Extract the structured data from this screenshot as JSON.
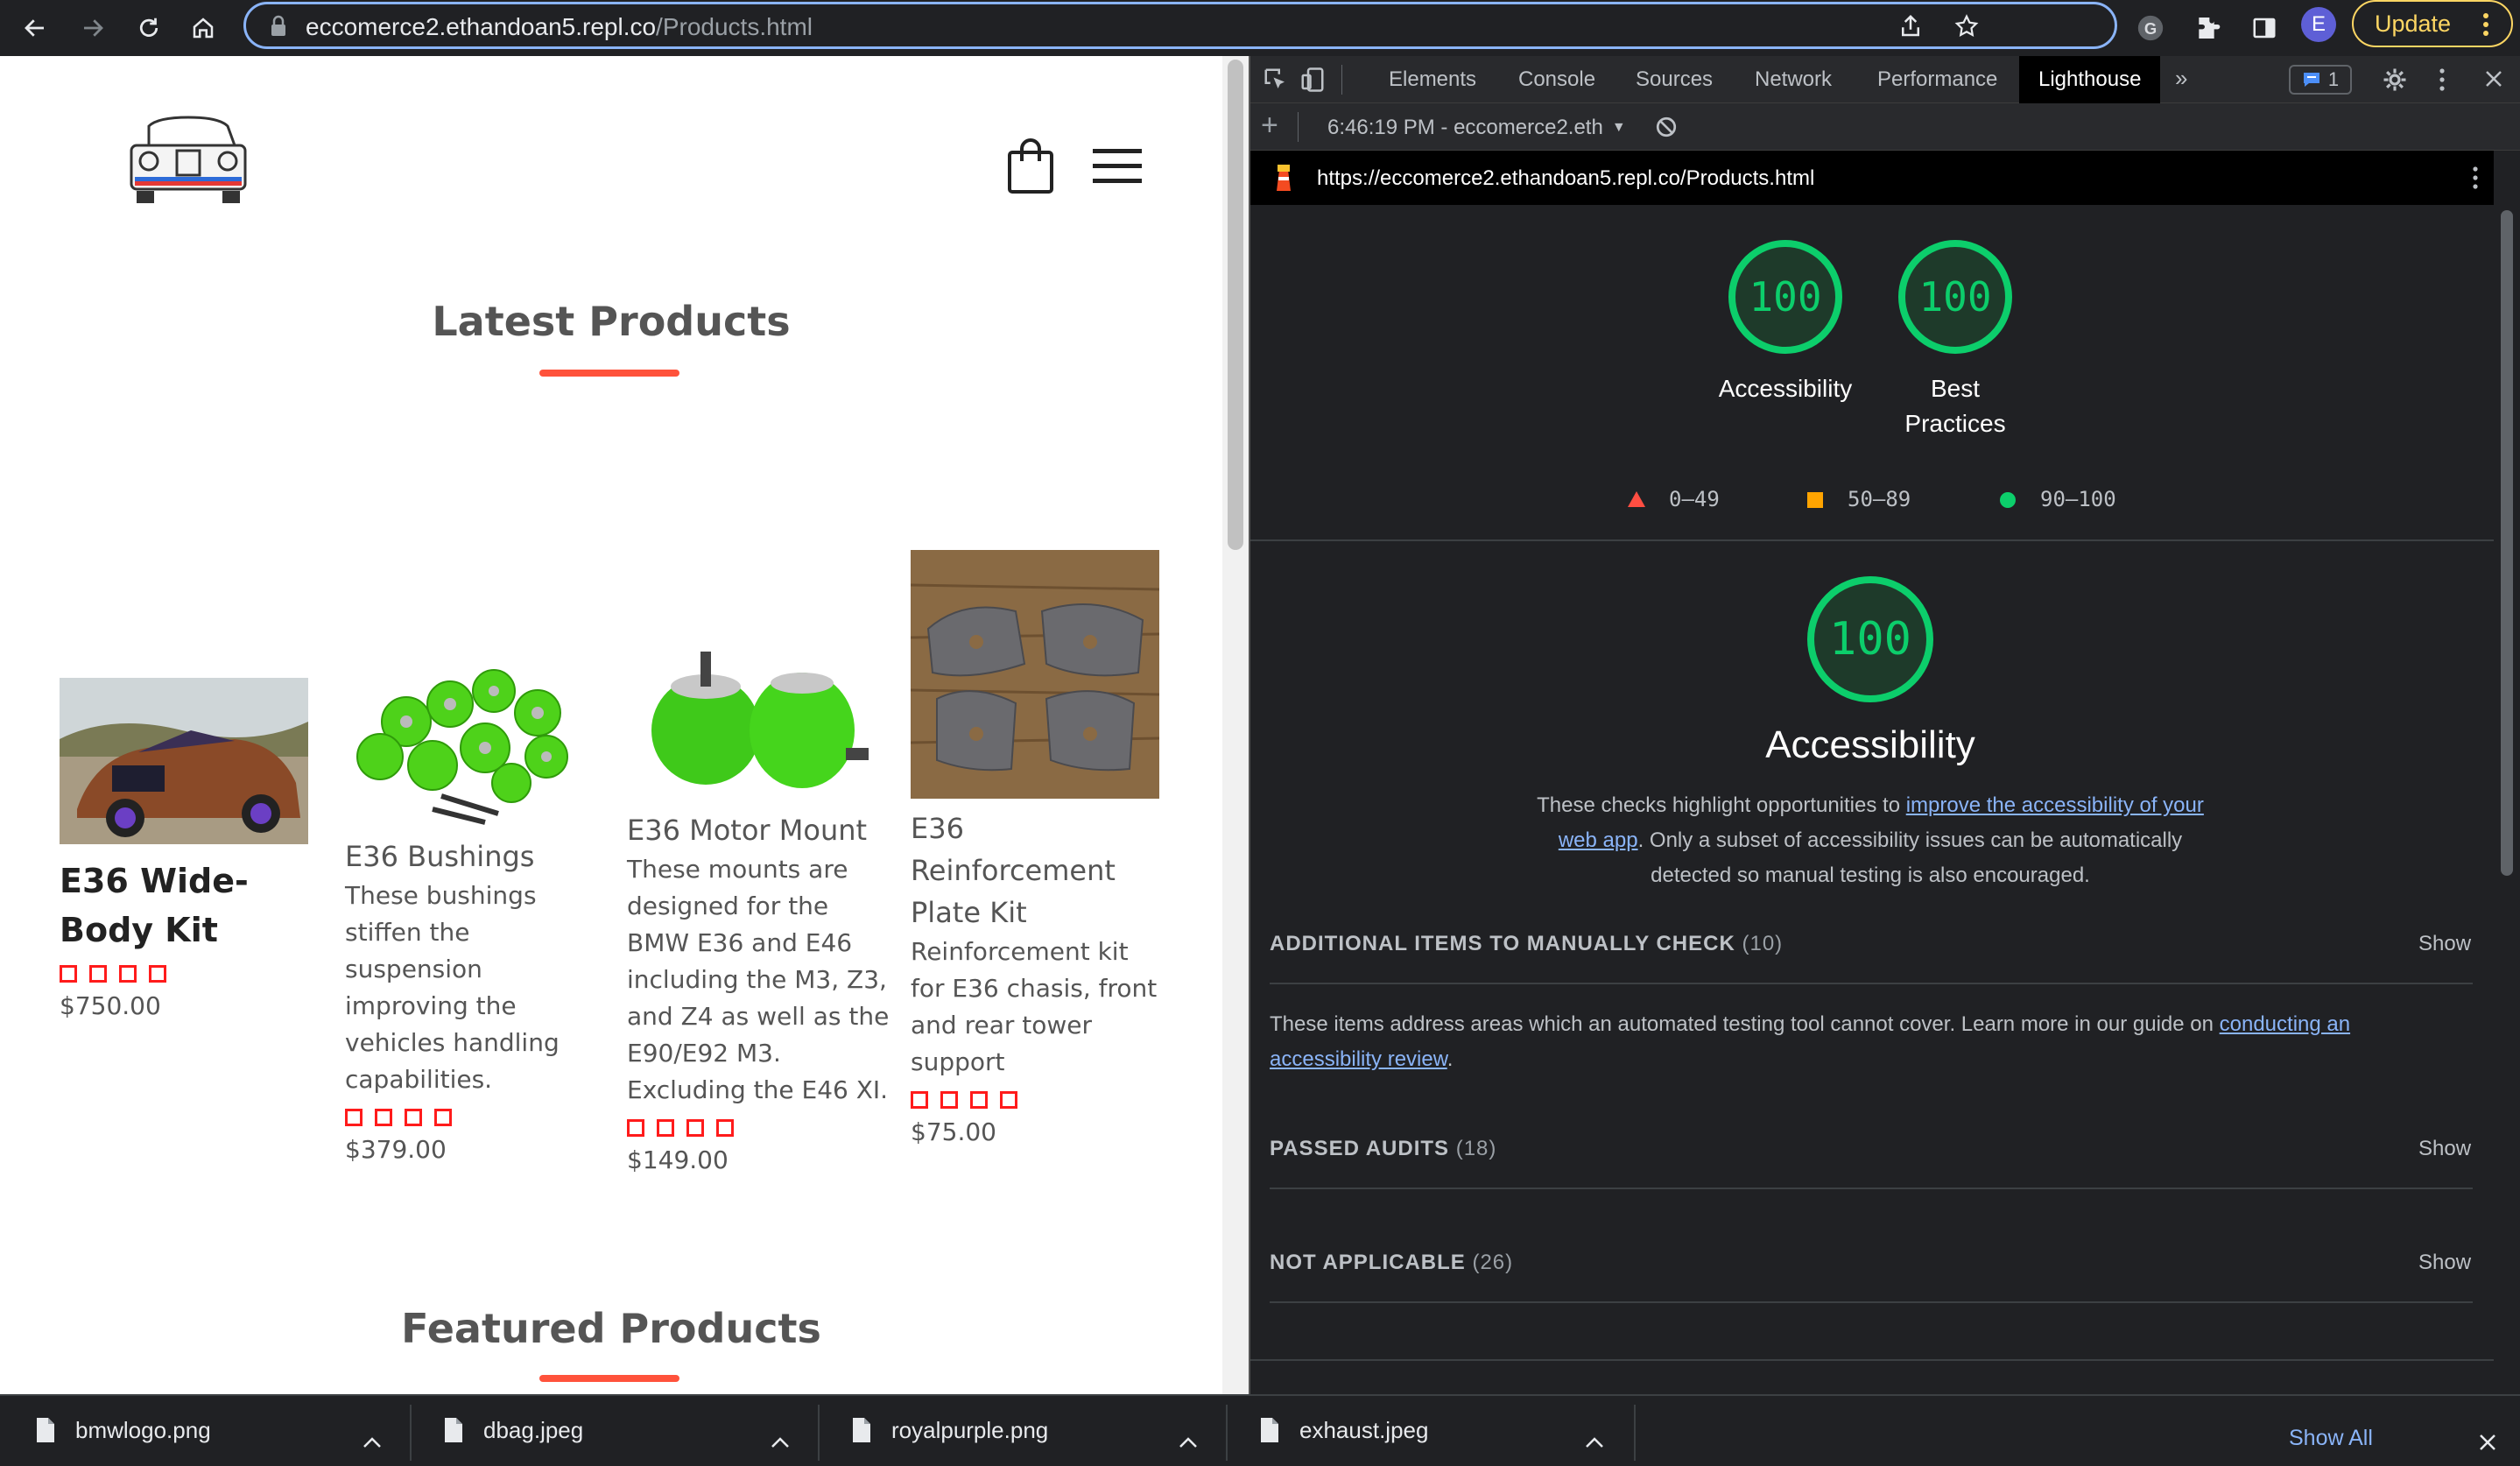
{
  "browser": {
    "url_host": "eccomerce2.ethandoan5.repl.co",
    "url_path": "/Products.html",
    "avatar_letter": "E",
    "update_label": "Update",
    "accent": "#8ab4f8",
    "update_color": "#fdd663"
  },
  "site": {
    "latest_title": "Latest Products",
    "featured_title": "Featured Products",
    "accent": "#ff523b",
    "products": [
      {
        "name": "E36 Wide-Body Kit",
        "description": "",
        "price": "$750.00"
      },
      {
        "name": "E36 Bushings",
        "description": "These bushings stiffen the suspension improving the vehicles handling capabilities.",
        "price": "$379.00"
      },
      {
        "name": "E36 Motor Mount",
        "description": "These mounts are designed for the BMW E36 and E46 including the M3, Z3, and Z4 as well as the E90/E92 M3. Excluding the E46 XI.",
        "price": "$149.00"
      },
      {
        "name": "E36 Reinforcement Plate Kit",
        "description": "Reinforcement kit for E36 chasis, front and rear tower support",
        "price": "$75.00"
      }
    ]
  },
  "devtools": {
    "tabs": [
      "Elements",
      "Console",
      "Sources",
      "Network",
      "Performance",
      "Lighthouse"
    ],
    "active_tab": "Lighthouse",
    "issues_count": "1",
    "report_selector": "6:46:19 PM - eccomerce2.eth",
    "report_url": "https://eccomerce2.ethandoan5.repl.co/Products.html",
    "scores": [
      {
        "label": "Accessibility",
        "score": "100"
      },
      {
        "label": "Best Practices",
        "score": "100"
      }
    ],
    "legend": [
      "0–49",
      "50–89",
      "90–100"
    ],
    "main_score": "100",
    "main_title": "Accessibility",
    "desc_pre": "These checks highlight opportunities to ",
    "desc_link": "improve the accessibility of your web app",
    "desc_post": ". Only a subset of accessibility issues can be automatically detected so manual testing is also encouraged.",
    "groups": [
      {
        "title": "ADDITIONAL ITEMS TO MANUALLY CHECK",
        "count": "(10)",
        "show": "Show"
      },
      {
        "title": "PASSED AUDITS",
        "count": "(18)",
        "show": "Show"
      },
      {
        "title": "NOT APPLICABLE",
        "count": "(26)",
        "show": "Show"
      }
    ],
    "manual_pre": "These items address areas which an automated testing tool cannot cover. Learn more in our guide on ",
    "manual_link": "conducting an accessibility review",
    "manual_post": ".",
    "colors": {
      "pass": "#0cce6b",
      "average": "#ffa400",
      "fail": "#ff4e42"
    }
  },
  "downloads": {
    "files": [
      "bmwlogo.png",
      "dbag.jpeg",
      "royalpurple.png",
      "exhaust.jpeg"
    ],
    "show_all": "Show All"
  }
}
